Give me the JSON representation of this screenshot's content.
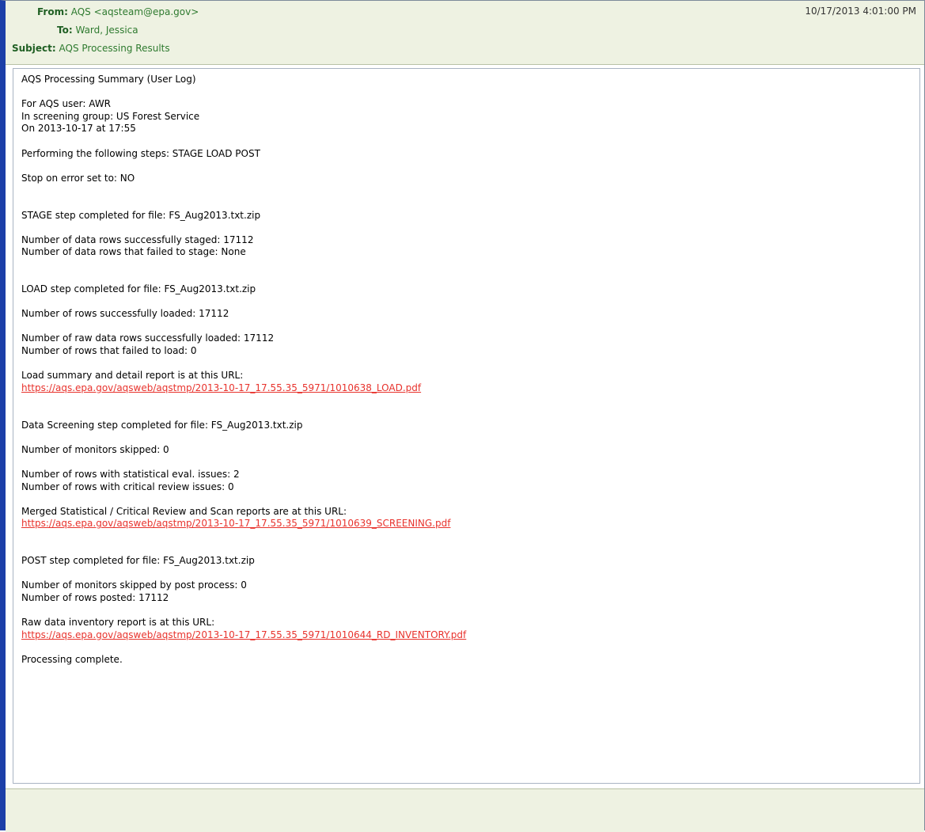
{
  "header": {
    "from_label": "From:",
    "from_value": "AQS <aqsteam@epa.gov>",
    "to_label": "To:",
    "to_value": "Ward, Jessica",
    "subject_label": "Subject:",
    "subject_value": "AQS Processing Results",
    "date": "10/17/2013 4:01:00 PM"
  },
  "body": {
    "title": "AQS Processing Summary (User Log)",
    "user": "For AQS user: AWR",
    "group": "In screening group: US Forest Service",
    "on_date": "On 2013-10-17 at 17:55",
    "steps": "Performing the following steps: STAGE LOAD POST",
    "stop_on_error": "Stop on error set to: NO",
    "stage_completed": "STAGE step completed for file: FS_Aug2013.txt.zip",
    "staged_ok": "Number of data rows successfully staged: 17112",
    "staged_failed": "Number of data rows that failed to stage: None",
    "load_completed": "LOAD step completed for file: FS_Aug2013.txt.zip",
    "rows_loaded": "Number of rows successfully loaded: 17112",
    "raw_rows_loaded": "Number of raw data rows successfully loaded: 17112",
    "rows_failed_load": "Number of rows that failed to load: 0",
    "load_report_label": "Load summary and detail report is at this URL:",
    "load_report_url": "https://aqs.epa.gov/aqsweb/aqstmp/2013-10-17_17.55.35_5971/1010638_LOAD.pdf",
    "screening_completed": "Data Screening step completed for file: FS_Aug2013.txt.zip",
    "monitors_skipped": "Number of monitors skipped: 0",
    "stat_issues": "Number of rows with statistical eval. issues: 2",
    "critical_issues": "Number of rows with critical review issues: 0",
    "screening_report_label": "Merged Statistical / Critical Review and Scan reports are at this URL:",
    "screening_report_url": "https://aqs.epa.gov/aqsweb/aqstmp/2013-10-17_17.55.35_5971/1010639_SCREENING.pdf",
    "post_completed": "POST step completed for file: FS_Aug2013.txt.zip",
    "post_monitors_skipped": "Number of monitors skipped by post process: 0",
    "rows_posted": "Number of rows posted: 17112",
    "inventory_label": "Raw data inventory report is at this URL:",
    "inventory_url": "https://aqs.epa.gov/aqsweb/aqstmp/2013-10-17_17.55.35_5971/1010644_RD_INVENTORY.pdf",
    "complete": "Processing complete."
  },
  "colors": {
    "header_bg": "#eef2e2",
    "header_label": "#1f5f23",
    "header_value": "#2e7a2f",
    "link": "#e8332d",
    "window_accent": "#1c3fa8"
  }
}
